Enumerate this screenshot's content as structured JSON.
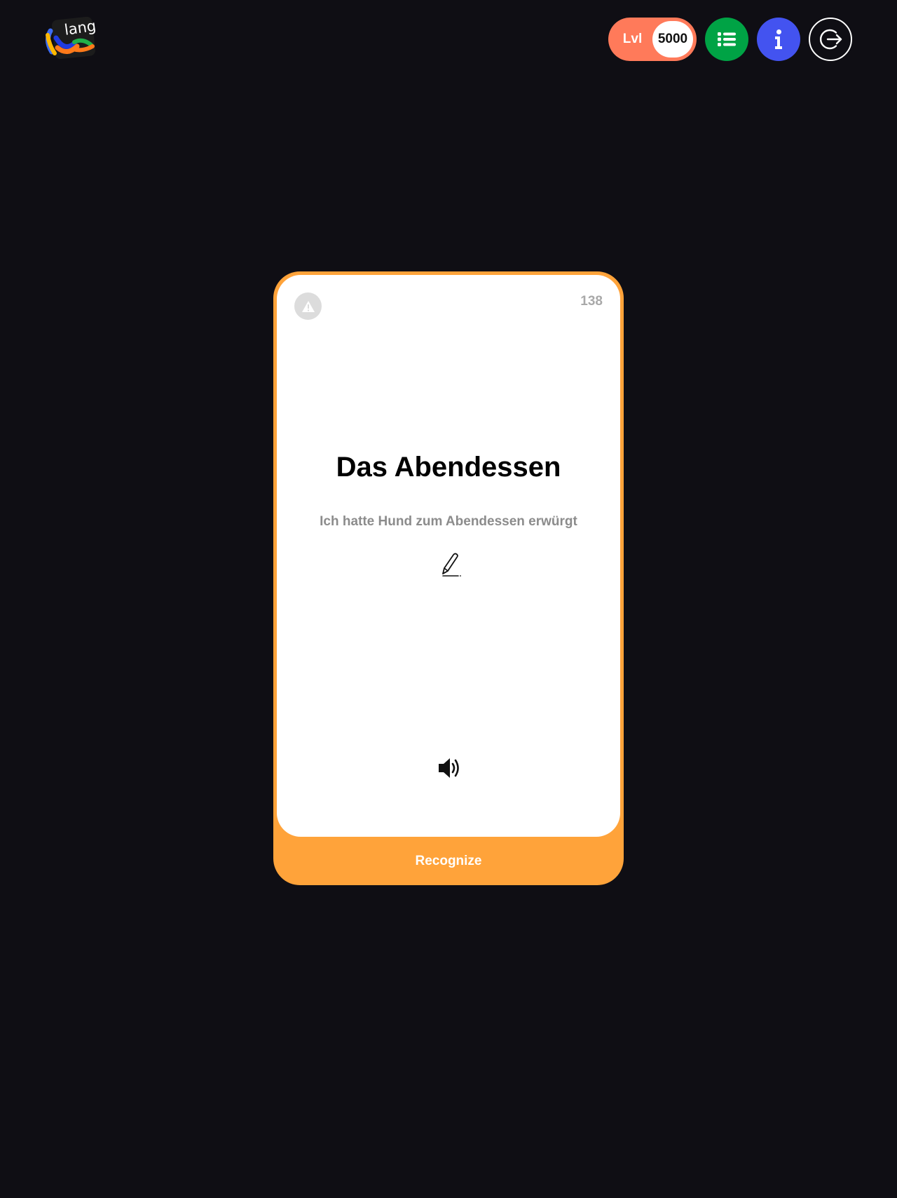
{
  "header": {
    "logo_text": "lang",
    "level": {
      "label": "Lvl",
      "value": "5000"
    },
    "buttons": {
      "list_icon": "list-icon",
      "info_icon": "info-icon",
      "logout_icon": "logout-icon"
    }
  },
  "card": {
    "number": "138",
    "word": "Das Abendessen",
    "sentence": "Ich hatte Hund zum Abendessen erwürgt",
    "warning_icon": "warning-icon",
    "edit_icon": "pencil-icon",
    "sound_icon": "speaker-icon",
    "action_label": "Recognize"
  },
  "colors": {
    "background": "#0f0e14",
    "level_pill": "#ff7a5a",
    "list_button": "#00a345",
    "info_button": "#4353f0",
    "card_border": "#ffa33a"
  }
}
